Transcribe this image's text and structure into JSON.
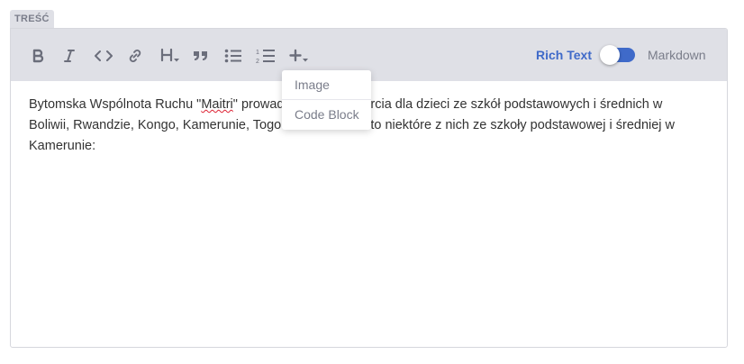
{
  "field": {
    "label": "TREŚĆ"
  },
  "toolbar": {
    "buttons": [
      {
        "name": "bold",
        "icon": "bold-icon"
      },
      {
        "name": "italic",
        "icon": "italic-icon"
      },
      {
        "name": "code",
        "icon": "code-icon"
      },
      {
        "name": "link",
        "icon": "link-icon"
      },
      {
        "name": "heading",
        "icon": "heading-icon"
      },
      {
        "name": "quote",
        "icon": "quote-icon"
      },
      {
        "name": "bulleted-list",
        "icon": "bulleted-list-icon"
      },
      {
        "name": "numbered-list",
        "icon": "numbered-list-icon"
      },
      {
        "name": "insert",
        "icon": "plus-icon"
      }
    ],
    "mode": {
      "rich_text": "Rich Text",
      "markdown": "Markdown",
      "active": "Rich Text"
    }
  },
  "dropdown": {
    "items": [
      "Image",
      "Code Block"
    ]
  },
  "content": {
    "before": "Bytomska Wspólnota Ruchu \"",
    "misspelled": "Maitri",
    "after": "\" prowadzi projekt wsparcia dla dzieci ze szkół podstawowych i średnich w Boliwii, Rwandzie, Kongo, Kamerunie, Togo i Gwatemali. Oto niektóre z nich ze szkoły podstawowej i średniej w Kamerunie:"
  },
  "colors": {
    "accent": "#3f6ac9",
    "toolbar_bg": "#dfe0e6",
    "icon": "#6b6e7b"
  }
}
